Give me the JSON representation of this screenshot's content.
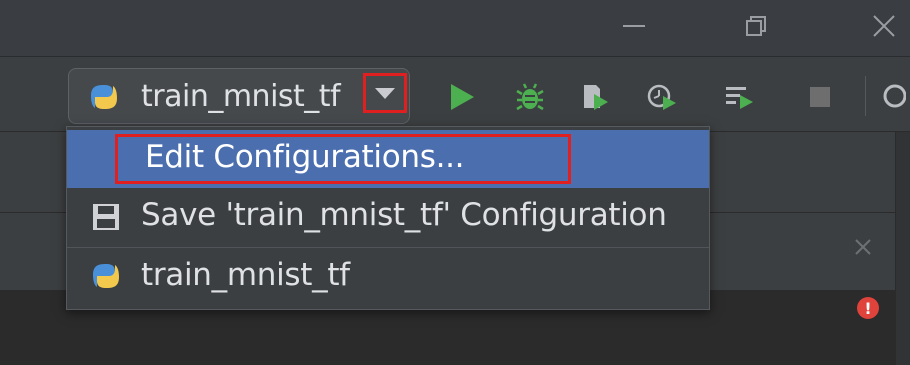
{
  "window": {
    "minimize_icon": "minimize-icon",
    "restore_icon": "restore-icon",
    "close_icon": "close-icon"
  },
  "toolbar": {
    "run_config": {
      "label": "train_mnist_tf",
      "icon": "python-icon"
    },
    "dropdown_icon": "chevron-down-icon",
    "actions": [
      {
        "name": "run",
        "icon": "play-icon",
        "color": "#4caf50"
      },
      {
        "name": "debug",
        "icon": "bug-icon",
        "color": "#4caf50"
      },
      {
        "name": "coverage",
        "icon": "coverage-icon",
        "color": "#4caf50"
      },
      {
        "name": "profile",
        "icon": "profiler-icon",
        "color": "#4caf50"
      },
      {
        "name": "run-concurrent",
        "icon": "run-list-icon",
        "color": "#4caf50"
      },
      {
        "name": "stop",
        "icon": "stop-icon",
        "color": "#6e6e6e"
      }
    ]
  },
  "menu": {
    "items": [
      {
        "label": "Edit Configurations...",
        "selected": true
      },
      {
        "label": "Save 'train_mnist_tf' Configuration",
        "icon": "save-icon"
      },
      {
        "label": "train_mnist_tf",
        "icon": "python-icon"
      }
    ]
  },
  "colors": {
    "highlight_box": "#e02020",
    "selection": "#4b6eaf",
    "accent_green": "#4caf50",
    "error": "#e0423c"
  }
}
